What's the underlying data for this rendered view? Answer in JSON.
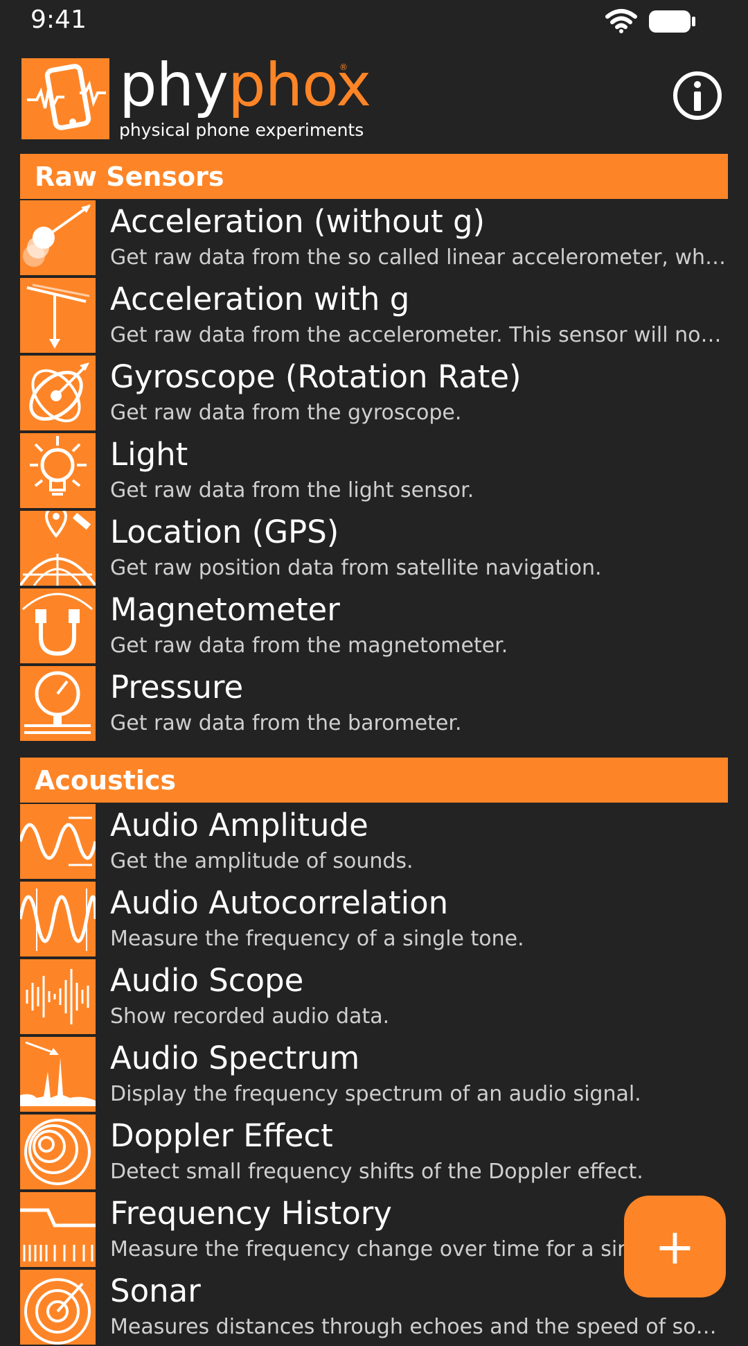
{
  "status_bar": {
    "time": "9:41",
    "wifi_icon": "wifi-icon",
    "battery_icon": "battery-icon"
  },
  "header": {
    "logo_text_part1": "phy",
    "logo_text_part2": "phox",
    "logo_registered": "®",
    "logo_tagline": "physical phone experiments",
    "info_icon": "info-icon"
  },
  "colors": {
    "accent": "#fe8527",
    "background": "#232323",
    "text_primary": "#ffffff",
    "text_secondary": "#cfcfcf"
  },
  "sections": {
    "raw_sensors": {
      "title": "Raw Sensors",
      "items": [
        {
          "icon": "acceleration-icon",
          "title": "Acceleration (without g)",
          "desc": "Get raw data from the so called linear accelerometer, which excludes gravity."
        },
        {
          "icon": "acceleration-g-icon",
          "title": "Acceleration with g",
          "desc": "Get raw data from the accelerometer. This sensor will not exclude gravity."
        },
        {
          "icon": "gyroscope-icon",
          "title": "Gyroscope (Rotation Rate)",
          "desc": "Get raw data from the gyroscope."
        },
        {
          "icon": "light-bulb-icon",
          "title": "Light",
          "desc": "Get raw data from the light sensor."
        },
        {
          "icon": "location-icon",
          "title": "Location (GPS)",
          "desc": "Get raw position data from satellite navigation."
        },
        {
          "icon": "magnet-icon",
          "title": "Magnetometer",
          "desc": "Get raw data from the magnetometer."
        },
        {
          "icon": "pressure-gauge-icon",
          "title": "Pressure",
          "desc": "Get raw data from the barometer."
        }
      ]
    },
    "acoustics": {
      "title": "Acoustics",
      "items": [
        {
          "icon": "audio-amplitude-icon",
          "title": "Audio Amplitude",
          "desc": "Get the amplitude of sounds."
        },
        {
          "icon": "audio-autocorrelation-icon",
          "title": "Audio Autocorrelation",
          "desc": "Measure the frequency of a single tone."
        },
        {
          "icon": "audio-scope-icon",
          "title": "Audio Scope",
          "desc": "Show recorded audio data."
        },
        {
          "icon": "audio-spectrum-icon",
          "title": "Audio Spectrum",
          "desc": "Display the frequency spectrum of an audio signal."
        },
        {
          "icon": "doppler-icon",
          "title": "Doppler Effect",
          "desc": "Detect small frequency shifts of the Doppler effect."
        },
        {
          "icon": "frequency-history-icon",
          "title": "Frequency History",
          "desc": "Measure the frequency change over time for a single tone."
        },
        {
          "icon": "sonar-icon",
          "title": "Sonar",
          "desc": "Measures distances through echoes and the speed of sound."
        }
      ]
    }
  },
  "fab": {
    "label": "+",
    "icon": "plus-icon"
  }
}
